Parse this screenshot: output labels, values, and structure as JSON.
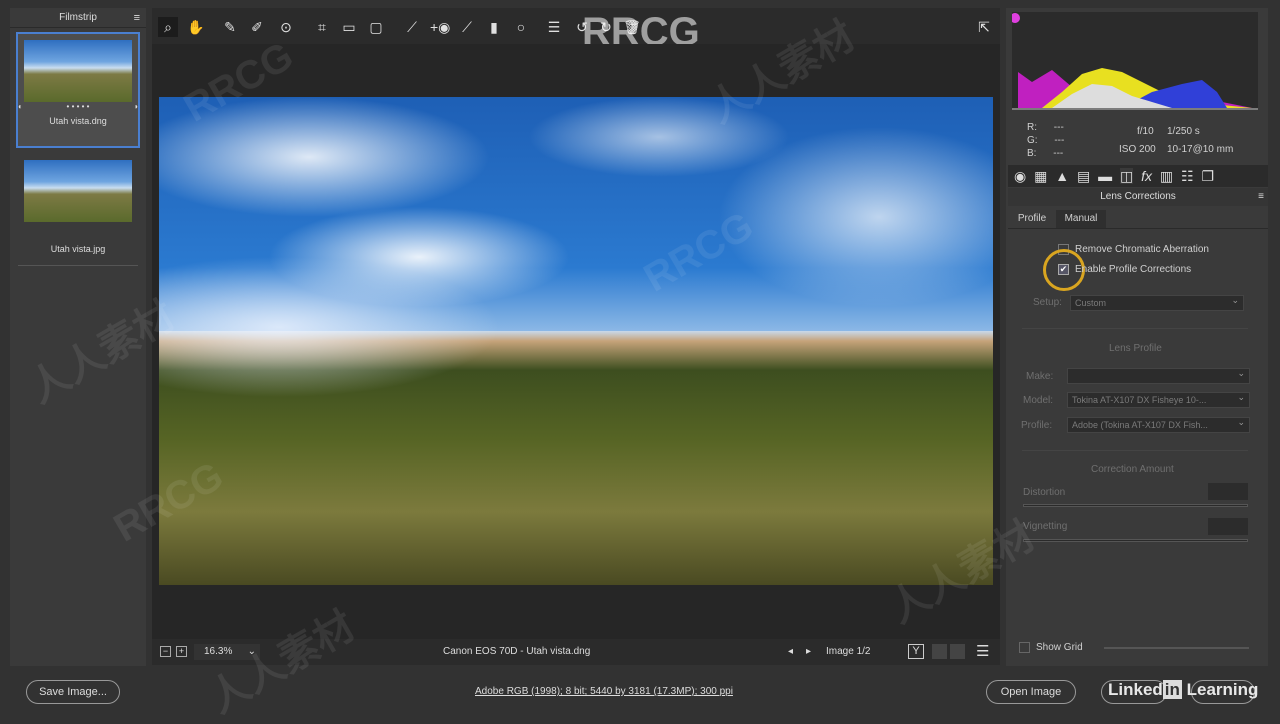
{
  "filmstrip": {
    "title": "Filmstrip",
    "items": [
      {
        "label": "Utah vista.dng",
        "selected": true,
        "rating_dots": "• • • • •"
      },
      {
        "label": "Utah vista.jpg",
        "selected": false
      }
    ]
  },
  "toolbar": {
    "tools": [
      "zoom-icon",
      "hand-icon",
      "white-balance-icon",
      "color-sampler-icon",
      "target-adjustment-icon",
      "crop-icon",
      "straighten-icon",
      "transform-icon",
      "spot-removal-icon",
      "red-eye-icon",
      "adjustment-brush-icon",
      "graduated-filter-icon",
      "radial-filter-icon",
      "preferences-icon",
      "rotate-left-icon",
      "rotate-right-icon",
      "trash-icon"
    ]
  },
  "watermark": "RRCG",
  "info": {
    "r_label": "R:",
    "g_label": "G:",
    "b_label": "B:",
    "r": "---",
    "g": "---",
    "b": "---",
    "aperture": "f/10",
    "shutter": "1/250 s",
    "iso": "ISO 200",
    "lens": "10-17@10 mm"
  },
  "panel": {
    "title": "Lens Corrections",
    "tabs": [
      "Profile",
      "Manual"
    ],
    "active_tab": "Profile",
    "remove_ca": {
      "label": "Remove Chromatic Aberration",
      "checked": false
    },
    "enable_profile": {
      "label": "Enable Profile Corrections",
      "checked": true
    },
    "setup_label": "Setup:",
    "setup_value": "Custom",
    "lens_profile_title": "Lens Profile",
    "make_label": "Make:",
    "make_value": "",
    "model_label": "Model:",
    "model_value": "Tokina AT-X107 DX Fisheye 10-...",
    "profile_label": "Profile:",
    "profile_value": "Adobe (Tokina AT-X107 DX Fish...",
    "correction_title": "Correction Amount",
    "distortion_label": "Distortion",
    "vignetting_label": "Vignetting",
    "show_grid_label": "Show Grid"
  },
  "bottom": {
    "zoom": "16.3%",
    "file_title": "Canon EOS 70D  -  Utah vista.dng",
    "image_counter": "Image 1/2",
    "before_after": "Y"
  },
  "footer": {
    "save_label": "Save Image...",
    "workflow_link": "Adobe RGB (1998); 8 bit; 5440 by 3181 (17.3MP); 300 ppi",
    "open_label": "Open Image",
    "logo": "Linked in Learning"
  }
}
